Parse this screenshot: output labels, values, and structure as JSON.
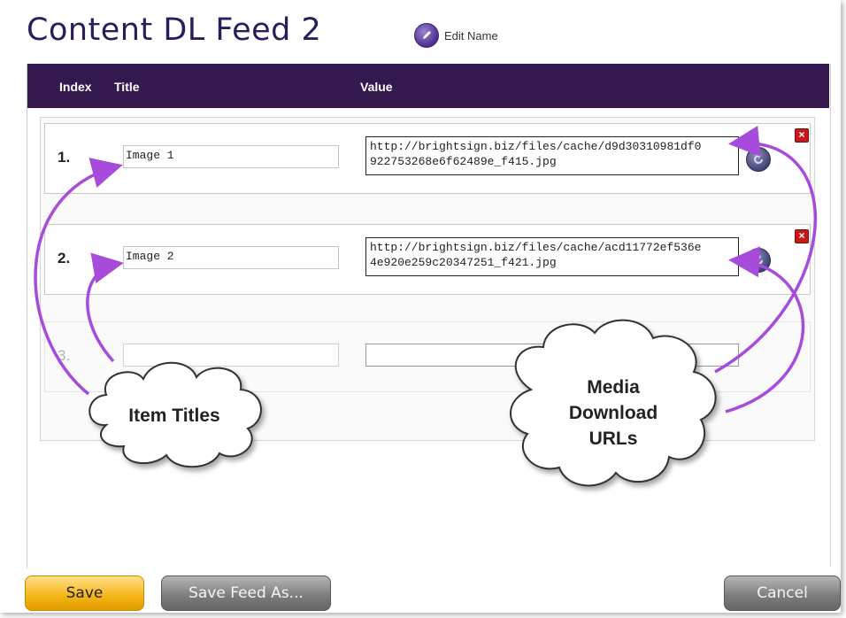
{
  "page": {
    "title": "Content DL Feed 2",
    "edit_name_label": "Edit Name"
  },
  "table": {
    "headers": {
      "index": "Index",
      "title": "Title",
      "value": "Value"
    },
    "rows": [
      {
        "index": "1.",
        "title": "Image 1",
        "url": "http://brightsign.biz/files/cache/d9d30310981df0\n922753268e6f62489e_f415.jpg"
      },
      {
        "index": "2.",
        "title": "Image 2",
        "url": "http://brightsign.biz/files/cache/acd11772ef536e\n4e920e259c20347251_f421.jpg"
      },
      {
        "index": "3.",
        "title": "",
        "url": ""
      }
    ]
  },
  "callouts": {
    "titles": "Item Titles",
    "urls": "Media\nDownload\nURLs"
  },
  "footer": {
    "save": "Save",
    "save_as": "Save Feed As...",
    "cancel": "Cancel"
  },
  "colors": {
    "header_bg": "#34194f",
    "annotation": "#a64bdb",
    "save_button": "#f4b416",
    "delete_button": "#c41a1a"
  }
}
